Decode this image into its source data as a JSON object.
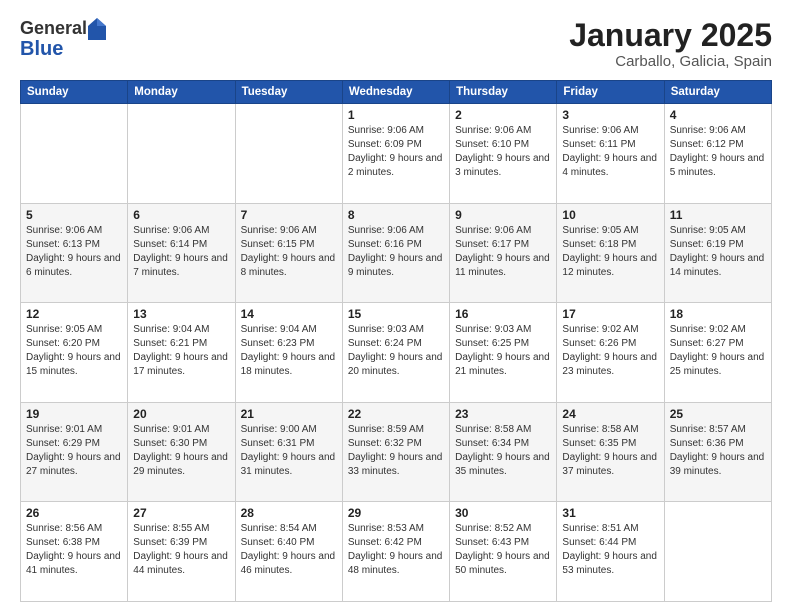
{
  "header": {
    "logo_general": "General",
    "logo_blue": "Blue",
    "month_title": "January 2025",
    "location": "Carballo, Galicia, Spain"
  },
  "weekdays": [
    "Sunday",
    "Monday",
    "Tuesday",
    "Wednesday",
    "Thursday",
    "Friday",
    "Saturday"
  ],
  "weeks": [
    [
      {
        "day": "",
        "info": ""
      },
      {
        "day": "",
        "info": ""
      },
      {
        "day": "",
        "info": ""
      },
      {
        "day": "1",
        "info": "Sunrise: 9:06 AM\nSunset: 6:09 PM\nDaylight: 9 hours and 2 minutes."
      },
      {
        "day": "2",
        "info": "Sunrise: 9:06 AM\nSunset: 6:10 PM\nDaylight: 9 hours and 3 minutes."
      },
      {
        "day": "3",
        "info": "Sunrise: 9:06 AM\nSunset: 6:11 PM\nDaylight: 9 hours and 4 minutes."
      },
      {
        "day": "4",
        "info": "Sunrise: 9:06 AM\nSunset: 6:12 PM\nDaylight: 9 hours and 5 minutes."
      }
    ],
    [
      {
        "day": "5",
        "info": "Sunrise: 9:06 AM\nSunset: 6:13 PM\nDaylight: 9 hours and 6 minutes."
      },
      {
        "day": "6",
        "info": "Sunrise: 9:06 AM\nSunset: 6:14 PM\nDaylight: 9 hours and 7 minutes."
      },
      {
        "day": "7",
        "info": "Sunrise: 9:06 AM\nSunset: 6:15 PM\nDaylight: 9 hours and 8 minutes."
      },
      {
        "day": "8",
        "info": "Sunrise: 9:06 AM\nSunset: 6:16 PM\nDaylight: 9 hours and 9 minutes."
      },
      {
        "day": "9",
        "info": "Sunrise: 9:06 AM\nSunset: 6:17 PM\nDaylight: 9 hours and 11 minutes."
      },
      {
        "day": "10",
        "info": "Sunrise: 9:05 AM\nSunset: 6:18 PM\nDaylight: 9 hours and 12 minutes."
      },
      {
        "day": "11",
        "info": "Sunrise: 9:05 AM\nSunset: 6:19 PM\nDaylight: 9 hours and 14 minutes."
      }
    ],
    [
      {
        "day": "12",
        "info": "Sunrise: 9:05 AM\nSunset: 6:20 PM\nDaylight: 9 hours and 15 minutes."
      },
      {
        "day": "13",
        "info": "Sunrise: 9:04 AM\nSunset: 6:21 PM\nDaylight: 9 hours and 17 minutes."
      },
      {
        "day": "14",
        "info": "Sunrise: 9:04 AM\nSunset: 6:23 PM\nDaylight: 9 hours and 18 minutes."
      },
      {
        "day": "15",
        "info": "Sunrise: 9:03 AM\nSunset: 6:24 PM\nDaylight: 9 hours and 20 minutes."
      },
      {
        "day": "16",
        "info": "Sunrise: 9:03 AM\nSunset: 6:25 PM\nDaylight: 9 hours and 21 minutes."
      },
      {
        "day": "17",
        "info": "Sunrise: 9:02 AM\nSunset: 6:26 PM\nDaylight: 9 hours and 23 minutes."
      },
      {
        "day": "18",
        "info": "Sunrise: 9:02 AM\nSunset: 6:27 PM\nDaylight: 9 hours and 25 minutes."
      }
    ],
    [
      {
        "day": "19",
        "info": "Sunrise: 9:01 AM\nSunset: 6:29 PM\nDaylight: 9 hours and 27 minutes."
      },
      {
        "day": "20",
        "info": "Sunrise: 9:01 AM\nSunset: 6:30 PM\nDaylight: 9 hours and 29 minutes."
      },
      {
        "day": "21",
        "info": "Sunrise: 9:00 AM\nSunset: 6:31 PM\nDaylight: 9 hours and 31 minutes."
      },
      {
        "day": "22",
        "info": "Sunrise: 8:59 AM\nSunset: 6:32 PM\nDaylight: 9 hours and 33 minutes."
      },
      {
        "day": "23",
        "info": "Sunrise: 8:58 AM\nSunset: 6:34 PM\nDaylight: 9 hours and 35 minutes."
      },
      {
        "day": "24",
        "info": "Sunrise: 8:58 AM\nSunset: 6:35 PM\nDaylight: 9 hours and 37 minutes."
      },
      {
        "day": "25",
        "info": "Sunrise: 8:57 AM\nSunset: 6:36 PM\nDaylight: 9 hours and 39 minutes."
      }
    ],
    [
      {
        "day": "26",
        "info": "Sunrise: 8:56 AM\nSunset: 6:38 PM\nDaylight: 9 hours and 41 minutes."
      },
      {
        "day": "27",
        "info": "Sunrise: 8:55 AM\nSunset: 6:39 PM\nDaylight: 9 hours and 44 minutes."
      },
      {
        "day": "28",
        "info": "Sunrise: 8:54 AM\nSunset: 6:40 PM\nDaylight: 9 hours and 46 minutes."
      },
      {
        "day": "29",
        "info": "Sunrise: 8:53 AM\nSunset: 6:42 PM\nDaylight: 9 hours and 48 minutes."
      },
      {
        "day": "30",
        "info": "Sunrise: 8:52 AM\nSunset: 6:43 PM\nDaylight: 9 hours and 50 minutes."
      },
      {
        "day": "31",
        "info": "Sunrise: 8:51 AM\nSunset: 6:44 PM\nDaylight: 9 hours and 53 minutes."
      },
      {
        "day": "",
        "info": ""
      }
    ]
  ]
}
